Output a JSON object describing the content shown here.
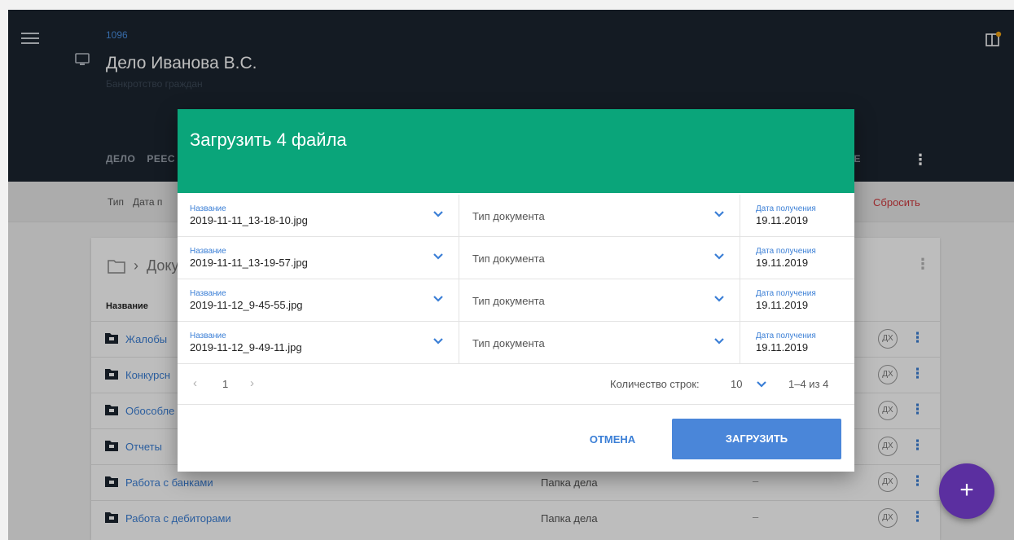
{
  "colors": {
    "header_bg": "#1c2530",
    "dialog_header": "#0aa57a",
    "accent_blue": "#3b7fd6",
    "primary_button": "#4a86d9",
    "reset_red": "#d0393e",
    "fab": "#5b2fa0"
  },
  "header": {
    "case_number": "1096",
    "title": "Дело Иванова В.С.",
    "subtitle": "Банкротство граждан",
    "icons": [
      "menu-icon",
      "monitor-icon",
      "panel-icon"
    ],
    "tabs": [
      {
        "label": "ДЕЛО"
      },
      {
        "label": "РЕЕС"
      }
    ],
    "tab_right": "ДЕ"
  },
  "filter_bar": {
    "labels": [
      "Тип",
      "Дата п"
    ],
    "reset": "Сбросить"
  },
  "card": {
    "path": "Доку",
    "column_name": "Название",
    "rows": [
      {
        "name": "Жалобы",
        "type": "",
        "date": ""
      },
      {
        "name": "Конкурсн",
        "type": "",
        "date": ""
      },
      {
        "name": "Обособле",
        "type": "",
        "date": ""
      },
      {
        "name": "Отчеты",
        "type": "",
        "date": ""
      },
      {
        "name": "Работа с банками",
        "type": "Папка дела",
        "date": "–"
      },
      {
        "name": "Работа с дебиторами",
        "type": "Папка дела",
        "date": "–"
      }
    ],
    "badge_text": "ДХ"
  },
  "dialog": {
    "title": "Загрузить 4 файла",
    "name_label": "Название",
    "type_placeholder": "Тип документа",
    "date_label": "Дата получения",
    "files": [
      {
        "name": "2019-11-11_13-18-10.jpg",
        "date": "19.11.2019"
      },
      {
        "name": "2019-11-11_13-19-57.jpg",
        "date": "19.11.2019"
      },
      {
        "name": "2019-11-12_9-45-55.jpg",
        "date": "19.11.2019"
      },
      {
        "name": "2019-11-12_9-49-11.jpg",
        "date": "19.11.2019"
      }
    ],
    "pagination": {
      "prev": "‹",
      "page": "1",
      "next": "›",
      "rows_label": "Количество строк:",
      "rows_value": "10",
      "range": "1–4 из 4"
    },
    "cancel": "ОТМЕНА",
    "upload": "ЗАГРУЗИТЬ"
  },
  "fab": "+"
}
